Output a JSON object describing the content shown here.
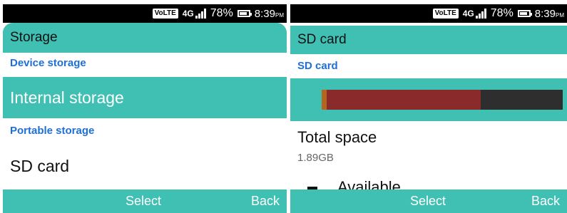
{
  "status_bar": {
    "volte": "VoLTE",
    "network": "4G",
    "battery_percent": "78%",
    "time": "8:39",
    "time_suffix": "PM"
  },
  "left_screen": {
    "title": "Storage",
    "device_storage_header": "Device storage",
    "internal_storage_label": "Internal storage",
    "portable_storage_header": "Portable storage",
    "sd_card_label": "SD card",
    "softkey_center": "Select",
    "softkey_right": "Back"
  },
  "right_screen": {
    "title": "SD card",
    "section_header": "SD card",
    "usage_bar": {
      "segments": [
        {
          "name": "other",
          "fraction": 0.02,
          "color": "#b5651d"
        },
        {
          "name": "used",
          "fraction": 0.64,
          "color": "#8b2a2a"
        }
      ],
      "free_color": "#2e2e2e"
    },
    "total_space_label": "Total space",
    "total_space_value": "1.89GB",
    "available_label": "Available",
    "softkey_center": "Select",
    "softkey_right": "Back"
  },
  "colors": {
    "accent": "#40bfb3",
    "section_text": "#1e6fd6",
    "status_bar": "#000000"
  }
}
